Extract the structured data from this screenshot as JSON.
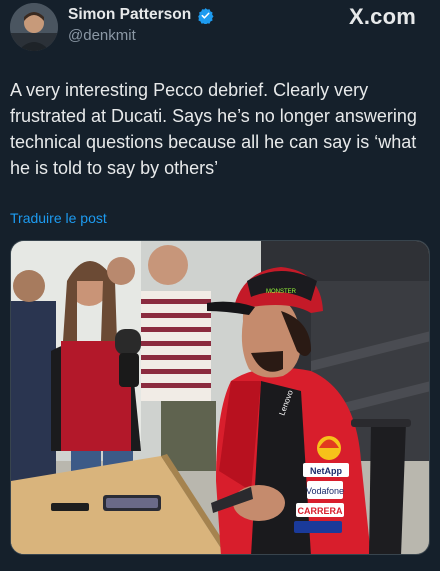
{
  "post": {
    "author_name": "Simon Patterson",
    "author_handle": "@denkmit",
    "brand": "X.com",
    "text": "A very interesting Pecco debrief. Clearly very frustrated at Ducati. Says he’s no longer answering technical questions because all he can say is ‘what he is told to say by others’",
    "translate_label": "Traduire le post"
  },
  "icons": {
    "verified": "verified-badge-icon"
  },
  "colors": {
    "background": "#15202b",
    "accent": "#1d9bf0",
    "text_primary": "#e7e9ea",
    "text_secondary": "#8b98a5",
    "jersey_red": "#d81e2c"
  },
  "media": {
    "cap_text": "MONSTER",
    "sponsor_1": "NetApp",
    "sponsor_2": "Vodafone",
    "sponsor_3": "CARRERA",
    "sponsor_4": "Lenovo"
  }
}
